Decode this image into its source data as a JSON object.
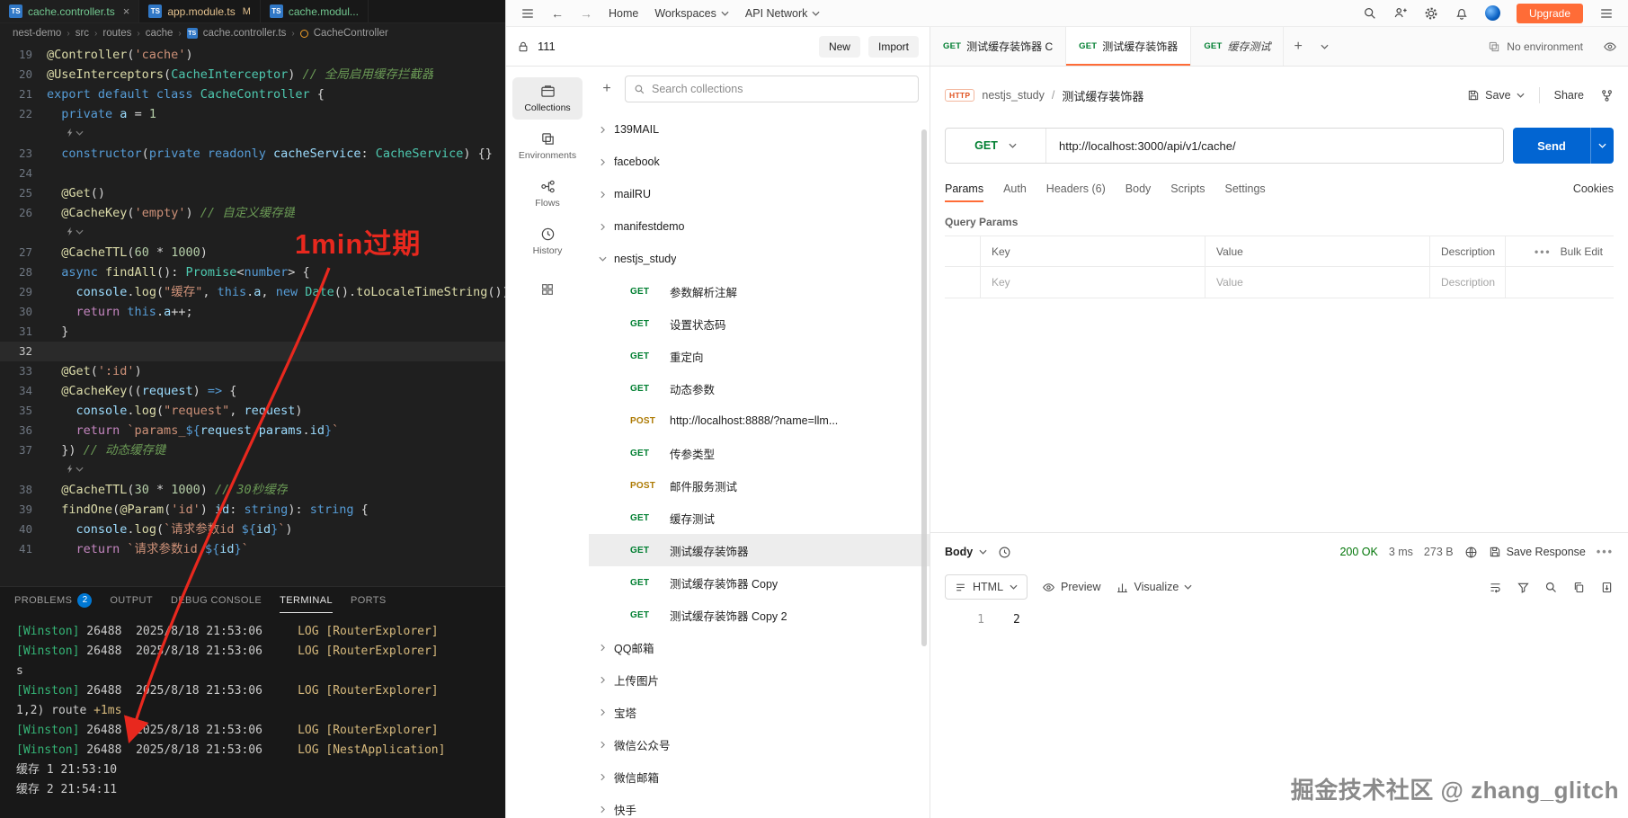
{
  "colors": {
    "postman_orange": "#ff6c37",
    "send_blue": "#0265d2",
    "status_green": "#007507",
    "annotation_red": "#e8281e",
    "methods": {
      "GET": "#007f31",
      "POST": "#ad7a03"
    }
  },
  "vscode": {
    "tabs": [
      {
        "label": "cache.controller.ts",
        "git": "added",
        "active": true
      },
      {
        "label": "app.module.ts",
        "git": "modified",
        "badge": "M"
      },
      {
        "label": "cache.modul...",
        "git": "added"
      }
    ],
    "breadcrumb": [
      "nest-demo",
      "src",
      "routes",
      "cache",
      "cache.controller.ts",
      "CacheController"
    ],
    "code_lines": [
      {
        "n": 19,
        "tk": [
          [
            "@Controller",
            "fn"
          ],
          [
            "(",
            "pun"
          ],
          [
            "'cache'",
            "str"
          ],
          [
            ")",
            "pun"
          ]
        ]
      },
      {
        "n": 20,
        "tk": [
          [
            "@UseInterceptors",
            "fn"
          ],
          [
            "(",
            "pun"
          ],
          [
            "CacheInterceptor",
            "type"
          ],
          [
            ") ",
            "pun"
          ],
          [
            "// 全局启用缓存拦截器",
            "cmt"
          ]
        ]
      },
      {
        "n": 21,
        "tk": [
          [
            "export default class ",
            "kw"
          ],
          [
            "CacheController",
            "type"
          ],
          [
            " {",
            "pun"
          ]
        ]
      },
      {
        "n": 22,
        "tk": [
          [
            "  ",
            "pun"
          ],
          [
            "private",
            "kw"
          ],
          [
            " a ",
            "var"
          ],
          [
            "= ",
            "pun"
          ],
          [
            "1",
            "num"
          ]
        ]
      },
      {
        "fold": true
      },
      {
        "n": 23,
        "tk": [
          [
            "  ",
            "pun"
          ],
          [
            "constructor",
            "kw"
          ],
          [
            "(",
            "pun"
          ],
          [
            "private readonly",
            "kw"
          ],
          [
            " cacheService",
            "var"
          ],
          [
            ": ",
            "pun"
          ],
          [
            "CacheService",
            "type"
          ],
          [
            ") {}",
            "pun"
          ]
        ]
      },
      {
        "n": 24,
        "tk": []
      },
      {
        "n": 25,
        "tk": [
          [
            "  ",
            "pun"
          ],
          [
            "@Get",
            "fn"
          ],
          [
            "()",
            "pun"
          ]
        ]
      },
      {
        "n": 26,
        "tk": [
          [
            "  ",
            "pun"
          ],
          [
            "@CacheKey",
            "fn"
          ],
          [
            "(",
            "pun"
          ],
          [
            "'empty'",
            "str"
          ],
          [
            ") ",
            "pun"
          ],
          [
            "// 自定义缓存键",
            "cmt"
          ]
        ]
      },
      {
        "fold": true
      },
      {
        "n": 27,
        "tk": [
          [
            "  ",
            "pun"
          ],
          [
            "@CacheTTL",
            "fn"
          ],
          [
            "(",
            "pun"
          ],
          [
            "60",
            "num"
          ],
          [
            " * ",
            "pun"
          ],
          [
            "1000",
            "num"
          ],
          [
            ")",
            "pun"
          ]
        ]
      },
      {
        "n": 28,
        "tk": [
          [
            "  ",
            "pun"
          ],
          [
            "async ",
            "kw"
          ],
          [
            "findAll",
            "fn"
          ],
          [
            "(): ",
            "pun"
          ],
          [
            "Promise",
            "type"
          ],
          [
            "<",
            "pun"
          ],
          [
            "number",
            "kw"
          ],
          [
            "> {",
            "pun"
          ]
        ]
      },
      {
        "n": 29,
        "tk": [
          [
            "    ",
            "pun"
          ],
          [
            "console",
            "var"
          ],
          [
            ".",
            "pun"
          ],
          [
            "log",
            "fn"
          ],
          [
            "(",
            "pun"
          ],
          [
            "\"缓存\"",
            "str"
          ],
          [
            ", ",
            "pun"
          ],
          [
            "this",
            "kw"
          ],
          [
            ".",
            "pun"
          ],
          [
            "a",
            "var"
          ],
          [
            ", ",
            "pun"
          ],
          [
            "new ",
            "kw"
          ],
          [
            "Date",
            "type"
          ],
          [
            "().",
            "pun"
          ],
          [
            "toLocaleTimeString",
            "fn"
          ],
          [
            "())",
            "pun"
          ]
        ]
      },
      {
        "n": 30,
        "tk": [
          [
            "    ",
            "pun"
          ],
          [
            "return ",
            "ctrl"
          ],
          [
            "this",
            "kw"
          ],
          [
            ".",
            "pun"
          ],
          [
            "a",
            "var"
          ],
          [
            "++;",
            "pun"
          ]
        ]
      },
      {
        "n": 31,
        "tk": [
          [
            "  }",
            "pun"
          ]
        ]
      },
      {
        "n": 32,
        "tk": [],
        "cur": true
      },
      {
        "n": 33,
        "tk": [
          [
            "  ",
            "pun"
          ],
          [
            "@Get",
            "fn"
          ],
          [
            "(",
            "pun"
          ],
          [
            "':id'",
            "str"
          ],
          [
            ")",
            "pun"
          ]
        ]
      },
      {
        "n": 34,
        "tk": [
          [
            "  ",
            "pun"
          ],
          [
            "@CacheKey",
            "fn"
          ],
          [
            "((",
            "pun"
          ],
          [
            "request",
            "var"
          ],
          [
            ") ",
            "pun"
          ],
          [
            "=> ",
            "kw"
          ],
          [
            "{",
            "pun"
          ]
        ]
      },
      {
        "n": 35,
        "tk": [
          [
            "    ",
            "pun"
          ],
          [
            "console",
            "var"
          ],
          [
            ".",
            "pun"
          ],
          [
            "log",
            "fn"
          ],
          [
            "(",
            "pun"
          ],
          [
            "\"request\"",
            "str"
          ],
          [
            ", ",
            "pun"
          ],
          [
            "request",
            "var"
          ],
          [
            ")",
            "pun"
          ]
        ]
      },
      {
        "n": 36,
        "tk": [
          [
            "    ",
            "pun"
          ],
          [
            "return ",
            "ctrl"
          ],
          [
            "`params_",
            "str"
          ],
          [
            "${",
            "kw"
          ],
          [
            "request",
            "var"
          ],
          [
            ".",
            "pun"
          ],
          [
            "params",
            "var"
          ],
          [
            ".",
            "pun"
          ],
          [
            "id",
            "var"
          ],
          [
            "}",
            "kw"
          ],
          [
            "`",
            "str"
          ]
        ]
      },
      {
        "n": 37,
        "tk": [
          [
            "  }) ",
            "pun"
          ],
          [
            "// 动态缓存键",
            "cmt"
          ]
        ]
      },
      {
        "fold": true
      },
      {
        "n": 38,
        "tk": [
          [
            "  ",
            "pun"
          ],
          [
            "@CacheTTL",
            "fn"
          ],
          [
            "(",
            "pun"
          ],
          [
            "30",
            "num"
          ],
          [
            " * ",
            "pun"
          ],
          [
            "1000",
            "num"
          ],
          [
            ") ",
            "pun"
          ],
          [
            "// 30秒缓存",
            "cmt"
          ]
        ]
      },
      {
        "n": 39,
        "tk": [
          [
            "  ",
            "pun"
          ],
          [
            "findOne",
            "fn"
          ],
          [
            "(",
            "pun"
          ],
          [
            "@Param",
            "fn"
          ],
          [
            "(",
            "pun"
          ],
          [
            "'id'",
            "str"
          ],
          [
            ") ",
            "pun"
          ],
          [
            "id",
            "var"
          ],
          [
            ": ",
            "pun"
          ],
          [
            "string",
            "kw"
          ],
          [
            "): ",
            "pun"
          ],
          [
            "string",
            "kw"
          ],
          [
            " {",
            "pun"
          ]
        ]
      },
      {
        "n": 40,
        "tk": [
          [
            "    ",
            "pun"
          ],
          [
            "console",
            "var"
          ],
          [
            ".",
            "pun"
          ],
          [
            "log",
            "fn"
          ],
          [
            "(",
            "pun"
          ],
          [
            "`请求参数id ",
            "str"
          ],
          [
            "${",
            "kw"
          ],
          [
            "id",
            "var"
          ],
          [
            "}",
            "kw"
          ],
          [
            "`",
            "str"
          ],
          [
            ")",
            "pun"
          ]
        ]
      },
      {
        "n": 41,
        "tk": [
          [
            "    ",
            "pun"
          ],
          [
            "return ",
            "ctrl"
          ],
          [
            "`请求参数id ",
            "str"
          ],
          [
            "${",
            "kw"
          ],
          [
            "id",
            "var"
          ],
          [
            "}",
            "kw"
          ],
          [
            "`",
            "str"
          ]
        ]
      }
    ],
    "panel_tabs": [
      {
        "label": "PROBLEMS",
        "badge": "2"
      },
      {
        "label": "OUTPUT"
      },
      {
        "label": "DEBUG CONSOLE"
      },
      {
        "label": "TERMINAL",
        "active": true
      },
      {
        "label": "PORTS"
      }
    ],
    "terminal_lines": [
      [
        [
          "[Winston] ",
          "green"
        ],
        [
          "26488  ",
          "fg"
        ],
        [
          "2025/8/18 21:53:06     ",
          "fg"
        ],
        [
          "LOG ",
          "yellow"
        ],
        [
          "[RouterExplorer] ",
          "yellow"
        ]
      ],
      [
        [
          "[Winston] ",
          "green"
        ],
        [
          "26488  ",
          "fg"
        ],
        [
          "2025/8/18 21:53:06     ",
          "fg"
        ],
        [
          "LOG ",
          "yellow"
        ],
        [
          "[RouterExplorer] ",
          "yellow"
        ]
      ],
      [
        [
          "s",
          "fg"
        ]
      ],
      [
        [
          "[Winston] ",
          "green"
        ],
        [
          "26488  ",
          "fg"
        ],
        [
          "2025/8/18 21:53:06     ",
          "fg"
        ],
        [
          "LOG ",
          "yellow"
        ],
        [
          "[RouterExplorer] ",
          "yellow"
        ]
      ],
      [
        [
          "1,2) route ",
          "fg"
        ],
        [
          "+1ms",
          "yellow"
        ]
      ],
      [
        [
          "[Winston] ",
          "green"
        ],
        [
          "26488  ",
          "fg"
        ],
        [
          "2025/8/18 21:53:06     ",
          "fg"
        ],
        [
          "LOG ",
          "yellow"
        ],
        [
          "[RouterExplorer] ",
          "yellow"
        ]
      ],
      [
        [
          "[Winston] ",
          "green"
        ],
        [
          "26488  ",
          "fg"
        ],
        [
          "2025/8/18 21:53:06     ",
          "fg"
        ],
        [
          "LOG ",
          "yellow"
        ],
        [
          "[NestApplication] ",
          "yellow"
        ]
      ],
      [
        [
          "缓存 1 21:53:10",
          "fg"
        ]
      ],
      [
        [
          "缓存 2 21:54:11",
          "fg"
        ]
      ]
    ],
    "annotation": {
      "text": "1min过期",
      "color": "#e8281e"
    }
  },
  "postman": {
    "topbar": {
      "home": "Home",
      "workspaces": "Workspaces",
      "api_network": "API Network",
      "upgrade": "Upgrade"
    },
    "workspace": {
      "name": "111",
      "new_label": "New",
      "import_label": "Import"
    },
    "rail": [
      {
        "label": "Collections",
        "icon": "collections",
        "active": true
      },
      {
        "label": "Environments",
        "icon": "environments"
      },
      {
        "label": "Flows",
        "icon": "flows"
      },
      {
        "label": "History",
        "icon": "history"
      }
    ],
    "search_placeholder": "Search collections",
    "tree": [
      {
        "label": "139MAIL"
      },
      {
        "label": "facebook"
      },
      {
        "label": "mailRU"
      },
      {
        "label": "manifestdemo"
      },
      {
        "label": "nestjs_study",
        "expanded": true
      },
      {
        "label": "参数解析注解",
        "method": "GET",
        "child": true
      },
      {
        "label": "设置状态码",
        "method": "GET",
        "child": true
      },
      {
        "label": "重定向",
        "method": "GET",
        "child": true
      },
      {
        "label": "动态参数",
        "method": "GET",
        "child": true
      },
      {
        "label": "http://localhost:8888/?name=llm...",
        "method": "POST",
        "child": true
      },
      {
        "label": "传参类型",
        "method": "GET",
        "child": true
      },
      {
        "label": "邮件服务测试",
        "method": "POST",
        "child": true
      },
      {
        "label": "缓存测试",
        "method": "GET",
        "child": true
      },
      {
        "label": "测试缓存装饰器",
        "method": "GET",
        "child": true,
        "selected": true
      },
      {
        "label": "测试缓存装饰器 Copy",
        "method": "GET",
        "child": true
      },
      {
        "label": "测试缓存装饰器 Copy 2",
        "method": "GET",
        "child": true
      },
      {
        "label": "QQ邮箱"
      },
      {
        "label": "上传图片"
      },
      {
        "label": "宝塔"
      },
      {
        "label": "微信公众号"
      },
      {
        "label": "微信邮箱"
      },
      {
        "label": "快手"
      }
    ],
    "request_tabs": [
      {
        "method": "GET",
        "label": "测试缓存装饰器 C"
      },
      {
        "method": "GET",
        "label": "测试缓存装饰器",
        "active": true
      },
      {
        "method": "GET",
        "label": "缓存测试",
        "italic": true
      }
    ],
    "environment_label": "No environment",
    "request": {
      "type_badge": "HTTP",
      "collection": "nestjs_study",
      "name": "测试缓存装饰器",
      "save_label": "Save",
      "share_label": "Share",
      "method": "GET",
      "url": "http://localhost:3000/api/v1/cache/",
      "send_label": "Send",
      "tabs": [
        {
          "label": "Params",
          "active": true
        },
        {
          "label": "Auth"
        },
        {
          "label": "Headers (6)"
        },
        {
          "label": "Body"
        },
        {
          "label": "Scripts"
        },
        {
          "label": "Settings"
        }
      ],
      "cookies_label": "Cookies",
      "query_params_title": "Query Params",
      "table": {
        "headers": [
          "Key",
          "Value",
          "Description"
        ],
        "bulk_edit_label": "Bulk Edit",
        "placeholders": [
          "Key",
          "Value",
          "Description"
        ]
      }
    },
    "response": {
      "body_label": "Body",
      "status": "200 OK",
      "time": "3 ms",
      "size": "273 B",
      "save_label": "Save Response",
      "format": "HTML",
      "preview_label": "Preview",
      "visualize_label": "Visualize",
      "lines": [
        {
          "n": "1",
          "content": "2"
        }
      ]
    },
    "watermark": "掘金技术社区 @ zhang_glitch"
  }
}
